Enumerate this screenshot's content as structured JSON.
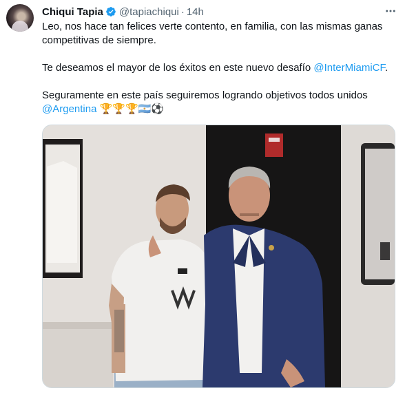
{
  "author": {
    "name": "Chiqui Tapia",
    "handle": "@tapiachiqui",
    "separator": "·",
    "time": "14h"
  },
  "icons": {
    "avatar": "profile-photo",
    "verified": "verified-badge-icon",
    "more": "more-options-icon"
  },
  "colors": {
    "link": "#1d9bf0",
    "verified": "#1d9bf0",
    "secondary_text": "#536471"
  },
  "tweet": {
    "p1": "Leo, nos hace tan felices verte contento, en familia, con las mismas ganas competitivas de siempre.",
    "p2_text": "Te deseamos el mayor de los éxitos en este nuevo desafío ",
    "p2_link": "@InterMiamiCF",
    "p2_end": ".",
    "p3_text": "Seguramente en este país seguiremos logrando objetivos todos unidos ",
    "p3_link": "@Argentina",
    "p3_emojis": "🏆🏆🏆🇦🇷⚽"
  },
  "media": {
    "type": "photo",
    "description_icon": "photo-two-men-posing"
  }
}
